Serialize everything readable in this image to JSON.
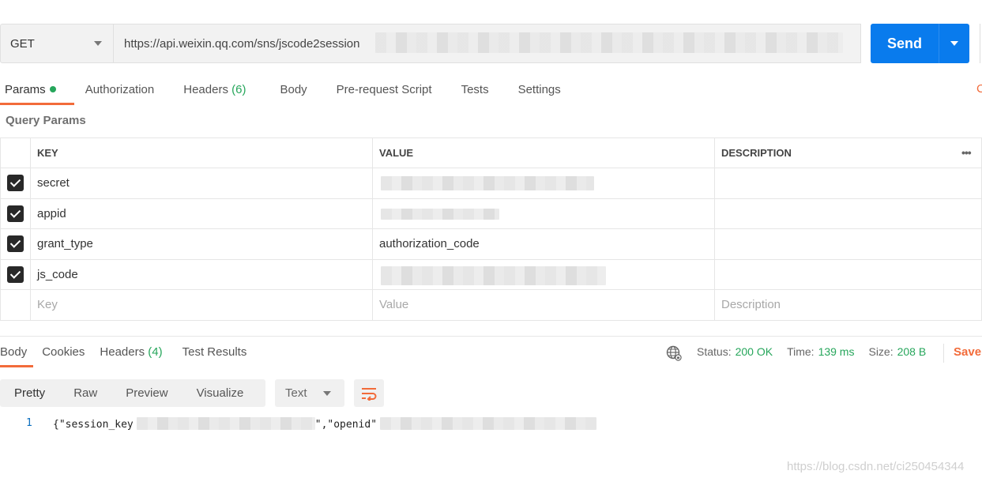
{
  "request": {
    "method": "GET",
    "url": "https://api.weixin.qq.com/sns/jscode2session",
    "send_label": "Send"
  },
  "request_tabs": {
    "params": "Params",
    "authorization": "Authorization",
    "headers": "Headers",
    "headers_count": "(6)",
    "body": "Body",
    "prerequest": "Pre-request Script",
    "tests": "Tests",
    "settings": "Settings",
    "cookies_edge": "C"
  },
  "query_params": {
    "section_label": "Query Params",
    "columns": {
      "key": "KEY",
      "value": "VALUE",
      "description": "DESCRIPTION"
    },
    "more": "•••",
    "rows": [
      {
        "key": "secret",
        "value": "",
        "checked": true
      },
      {
        "key": "appid",
        "value": "",
        "checked": true
      },
      {
        "key": "grant_type",
        "value": "authorization_code",
        "checked": true
      },
      {
        "key": "js_code",
        "value": "",
        "checked": true
      }
    ],
    "placeholders": {
      "key": "Key",
      "value": "Value",
      "description": "Description"
    }
  },
  "response": {
    "tabs": {
      "body": "Body",
      "cookies": "Cookies",
      "headers": "Headers",
      "headers_count": "(4)",
      "test_results": "Test Results"
    },
    "status_label": "Status:",
    "status_value": "200 OK",
    "time_label": "Time:",
    "time_value": "139 ms",
    "size_label": "Size:",
    "size_value": "208 B",
    "save_label": "Save",
    "view_modes": [
      "Pretty",
      "Raw",
      "Preview",
      "Visualize"
    ],
    "format": "Text",
    "line_number": "1",
    "code_part1": "{\"session_key",
    "code_part2": "\",\"openid\""
  },
  "watermark": "https://blog.csdn.net/ci250454344",
  "colors": {
    "accent": "#f26b3a",
    "send": "#097bed",
    "success": "#26a65b"
  }
}
